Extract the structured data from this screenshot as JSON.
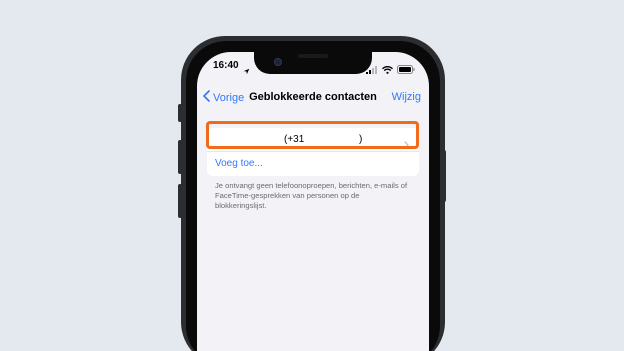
{
  "status_bar": {
    "time": "16:40"
  },
  "nav": {
    "back_label": "Vorige",
    "title": "Geblokkeerde contacten",
    "edit_label": "Wijzig"
  },
  "blocked_list": {
    "items": [
      {
        "prefix": "(+31",
        "suffix": ")"
      }
    ],
    "add_label": "Voeg toe..."
  },
  "footnote": "Je ontvangt geen telefoonoproepen, berichten, e-mails of FaceTime-gesprekken van personen op de blokkeringslijst.",
  "colors": {
    "accent": "#3478f6",
    "highlight": "#f26b1d",
    "background": "#e4e8ef",
    "screen": "#f2f2f7"
  },
  "icons": [
    "location-arrow-icon",
    "cellular-icon",
    "wifi-icon",
    "battery-icon",
    "chevron-left-icon",
    "chevron-right-icon"
  ]
}
